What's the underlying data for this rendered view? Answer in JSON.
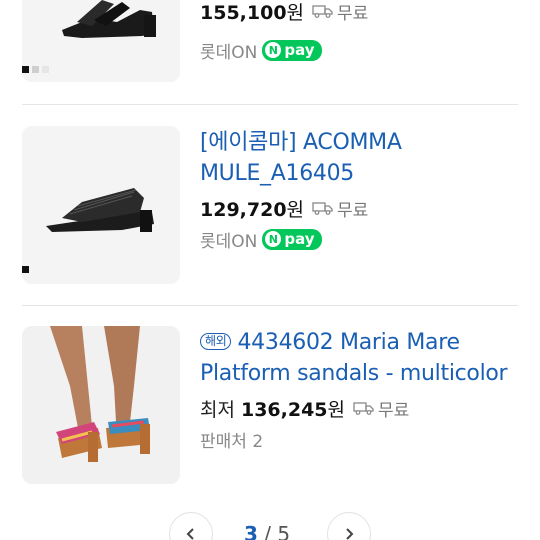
{
  "products": [
    {
      "title": "",
      "price": "155,100",
      "won": "원",
      "shipping": "무료",
      "seller": "롯데ON",
      "npay": "pay",
      "npay_n": "N",
      "swatch_colors": [
        "#111111",
        "#cfcfcf",
        "#e6e6e6"
      ]
    },
    {
      "title": "[에이콤마] ACOMMA MULE_A16405",
      "price": "129,720",
      "won": "원",
      "shipping": "무료",
      "seller": "롯데ON",
      "npay": "pay",
      "npay_n": "N",
      "swatch_colors": [
        "#111111"
      ]
    },
    {
      "badge": "해외",
      "title": "4434602 Maria Mare Platform sandals - multicolor",
      "price_prefix": "최저",
      "price": "136,245",
      "won": "원",
      "shipping": "무료",
      "seller": "판매처 2"
    }
  ],
  "pagination": {
    "current": "3",
    "separator": " / ",
    "total": "5",
    "prev_icon": "chevron-left-icon",
    "next_icon": "chevron-right-icon"
  },
  "colors": {
    "link": "#1a5fb4",
    "npay_green": "#03c75a"
  }
}
